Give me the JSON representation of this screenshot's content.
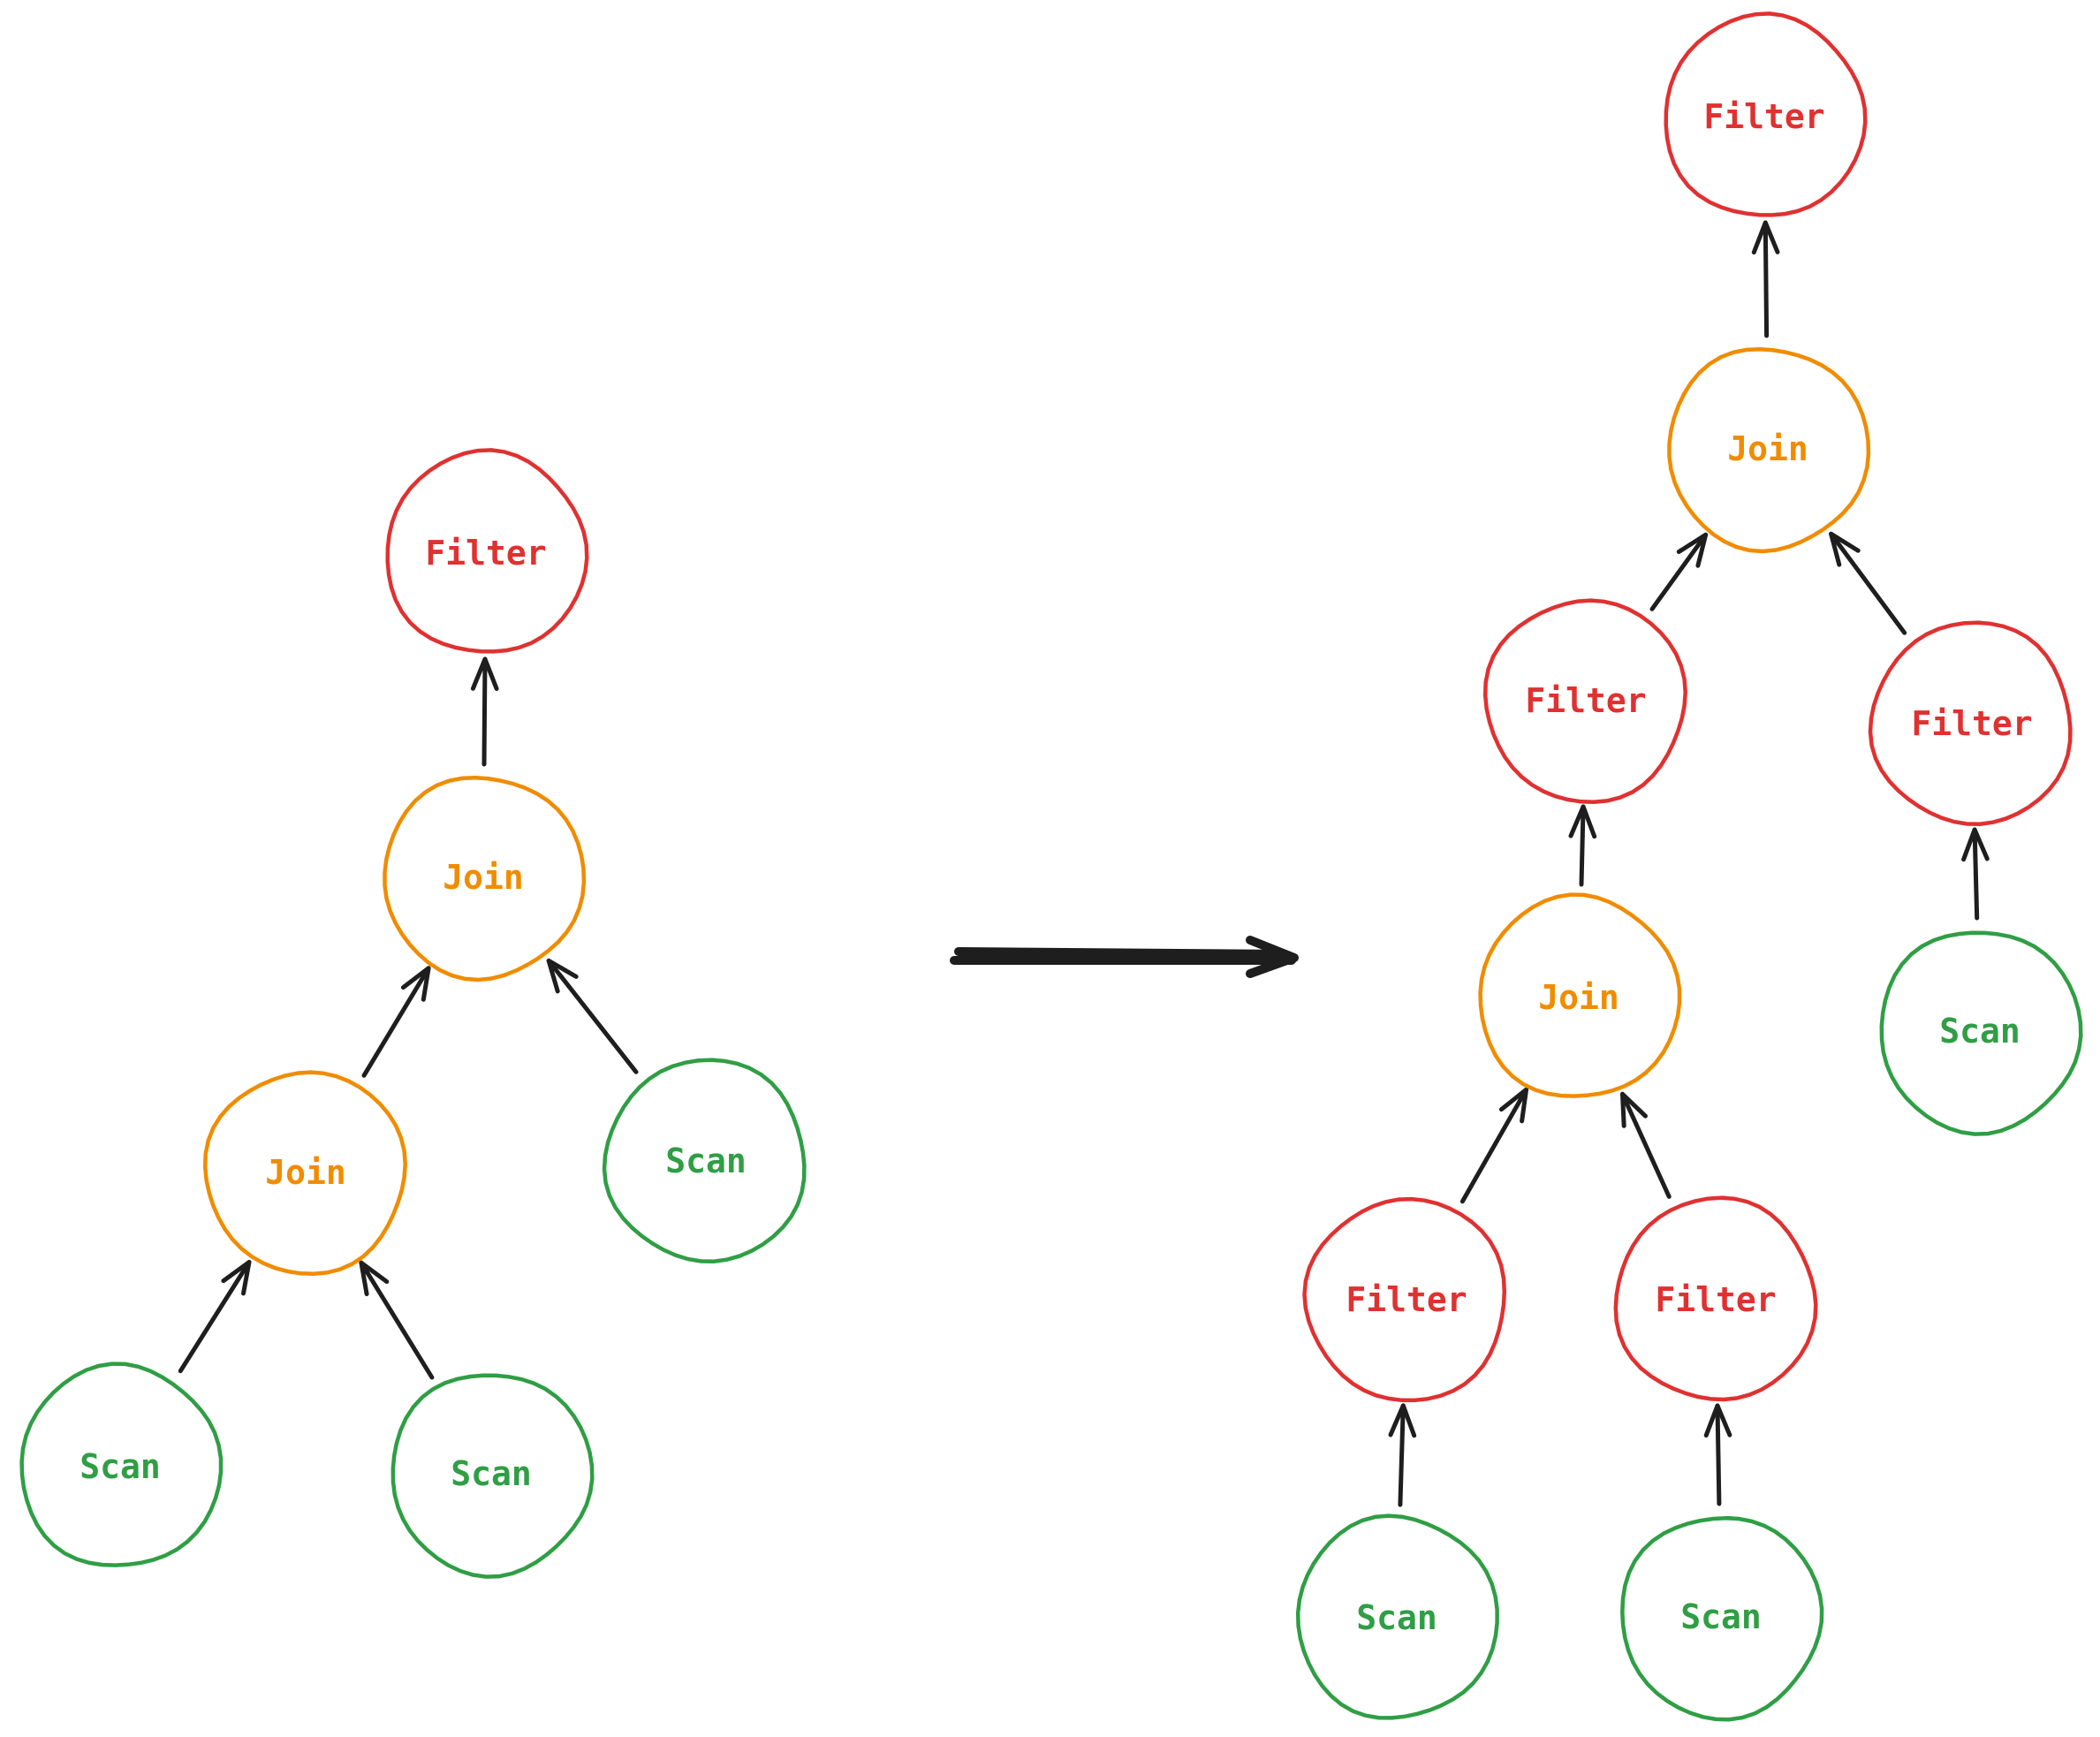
{
  "colors": {
    "filter": "#e03131",
    "join": "#f08c00",
    "scan": "#2f9e44",
    "edge": "#1e1e1e"
  },
  "left_tree": {
    "nodes": [
      {
        "id": "L_filter",
        "label": "Filter",
        "type": "filter"
      },
      {
        "id": "L_join_top",
        "label": "Join",
        "type": "join"
      },
      {
        "id": "L_join_bottom",
        "label": "Join",
        "type": "join"
      },
      {
        "id": "L_scan_right",
        "label": "Scan",
        "type": "scan"
      },
      {
        "id": "L_scan_bl",
        "label": "Scan",
        "type": "scan"
      },
      {
        "id": "L_scan_br",
        "label": "Scan",
        "type": "scan"
      }
    ],
    "edges": [
      {
        "from": "L_join_top",
        "to": "L_filter"
      },
      {
        "from": "L_join_bottom",
        "to": "L_join_top"
      },
      {
        "from": "L_scan_right",
        "to": "L_join_top"
      },
      {
        "from": "L_scan_bl",
        "to": "L_join_bottom"
      },
      {
        "from": "L_scan_br",
        "to": "L_join_bottom"
      }
    ]
  },
  "transform_arrow": {
    "label": "transforms-to"
  },
  "right_tree": {
    "nodes": [
      {
        "id": "R_filter_top",
        "label": "Filter",
        "type": "filter"
      },
      {
        "id": "R_join_top",
        "label": "Join",
        "type": "join"
      },
      {
        "id": "R_filter_left",
        "label": "Filter",
        "type": "filter"
      },
      {
        "id": "R_filter_right",
        "label": "Filter",
        "type": "filter"
      },
      {
        "id": "R_join_mid",
        "label": "Join",
        "type": "join"
      },
      {
        "id": "R_scan_right",
        "label": "Scan",
        "type": "scan"
      },
      {
        "id": "R_filter_bl",
        "label": "Filter",
        "type": "filter"
      },
      {
        "id": "R_filter_br",
        "label": "Filter",
        "type": "filter"
      },
      {
        "id": "R_scan_bl",
        "label": "Scan",
        "type": "scan"
      },
      {
        "id": "R_scan_br",
        "label": "Scan",
        "type": "scan"
      }
    ],
    "edges": [
      {
        "from": "R_join_top",
        "to": "R_filter_top"
      },
      {
        "from": "R_filter_left",
        "to": "R_join_top"
      },
      {
        "from": "R_filter_right",
        "to": "R_join_top"
      },
      {
        "from": "R_join_mid",
        "to": "R_filter_left"
      },
      {
        "from": "R_scan_right",
        "to": "R_filter_right"
      },
      {
        "from": "R_filter_bl",
        "to": "R_join_mid"
      },
      {
        "from": "R_filter_br",
        "to": "R_join_mid"
      },
      {
        "from": "R_scan_bl",
        "to": "R_filter_bl"
      },
      {
        "from": "R_scan_br",
        "to": "R_filter_br"
      }
    ]
  }
}
